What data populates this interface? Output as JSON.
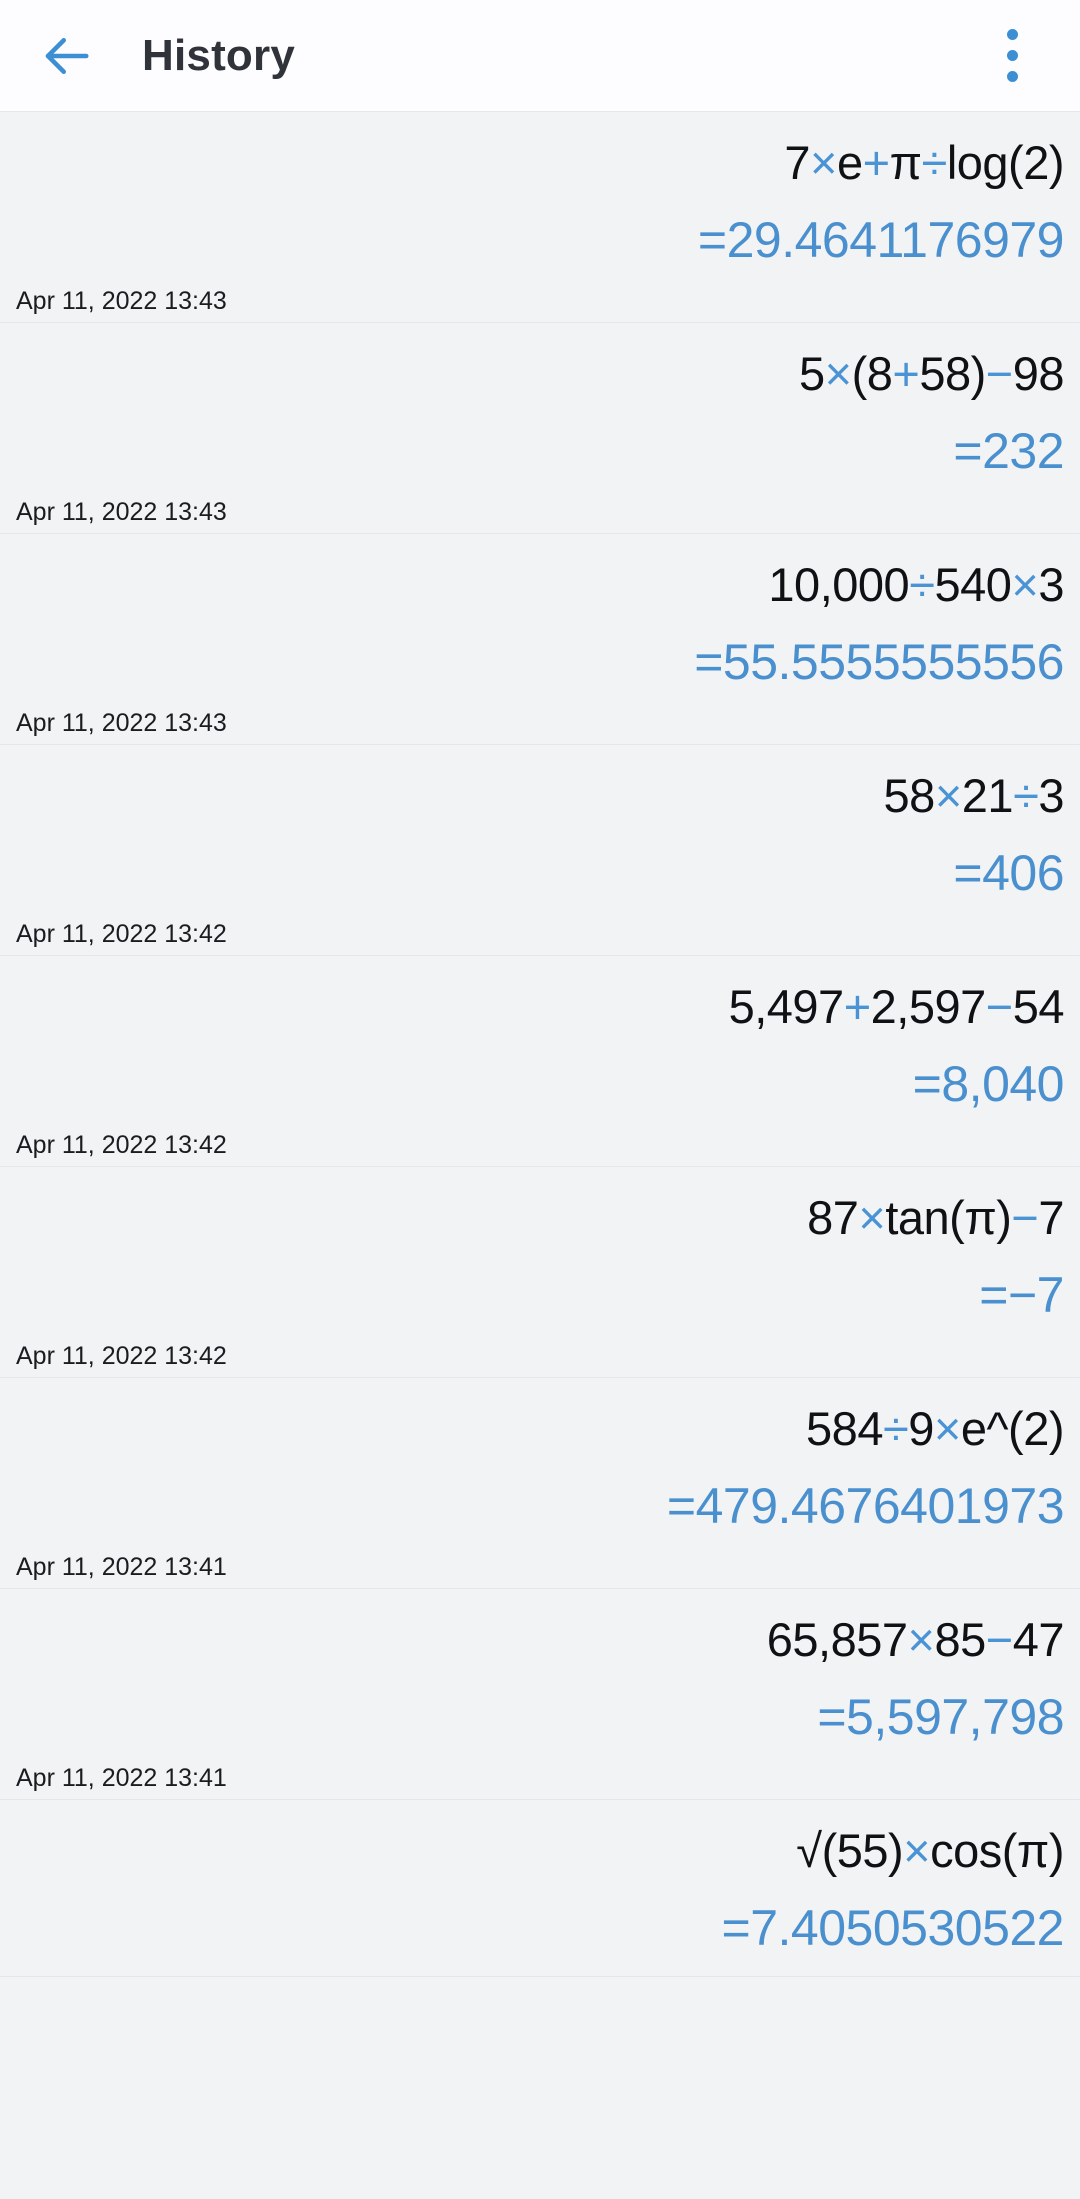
{
  "header": {
    "title": "History",
    "back_icon": "back-arrow-icon",
    "overflow_icon": "more-vertical-icon",
    "accent_color": "#3d8fd4",
    "title_color": "#30343a"
  },
  "colors": {
    "operator_blue": "#4a93d4",
    "result_blue": "#4a90cf",
    "expression_black": "#101114",
    "row_background": "#f2f3f5",
    "header_background": "#fdfdff",
    "divider": "#e4e6e9"
  },
  "history": [
    {
      "expression_parts": [
        {
          "t": "7",
          "op": false
        },
        {
          "t": "×",
          "op": true
        },
        {
          "t": "e",
          "op": false
        },
        {
          "t": "+",
          "op": true
        },
        {
          "t": "π",
          "op": false
        },
        {
          "t": "÷",
          "op": true
        },
        {
          "t": "log(2)",
          "op": false
        }
      ],
      "expression": "7×e+π÷log(2)",
      "result": "=29.4641176979",
      "timestamp": "Apr 11, 2022 13:43"
    },
    {
      "expression_parts": [
        {
          "t": "5",
          "op": false
        },
        {
          "t": "×",
          "op": true
        },
        {
          "t": "(8",
          "op": false
        },
        {
          "t": "+",
          "op": true
        },
        {
          "t": "58)",
          "op": false
        },
        {
          "t": "−",
          "op": true
        },
        {
          "t": "98",
          "op": false
        }
      ],
      "expression": "5×(8+58)−98",
      "result": "=232",
      "timestamp": "Apr 11, 2022 13:43"
    },
    {
      "expression_parts": [
        {
          "t": "10,000",
          "op": false
        },
        {
          "t": "÷",
          "op": true
        },
        {
          "t": "540",
          "op": false
        },
        {
          "t": "×",
          "op": true
        },
        {
          "t": "3",
          "op": false
        }
      ],
      "expression": "10,000÷540×3",
      "result": "=55.5555555556",
      "timestamp": "Apr 11, 2022 13:43"
    },
    {
      "expression_parts": [
        {
          "t": "58",
          "op": false
        },
        {
          "t": "×",
          "op": true
        },
        {
          "t": "21",
          "op": false
        },
        {
          "t": "÷",
          "op": true
        },
        {
          "t": "3",
          "op": false
        }
      ],
      "expression": "58×21÷3",
      "result": "=406",
      "timestamp": "Apr 11, 2022 13:42"
    },
    {
      "expression_parts": [
        {
          "t": "5,497",
          "op": false
        },
        {
          "t": "+",
          "op": true
        },
        {
          "t": "2,597",
          "op": false
        },
        {
          "t": "−",
          "op": true
        },
        {
          "t": "54",
          "op": false
        }
      ],
      "expression": "5,497+2,597−54",
      "result": "=8,040",
      "timestamp": "Apr 11, 2022 13:42"
    },
    {
      "expression_parts": [
        {
          "t": "87",
          "op": false
        },
        {
          "t": "×",
          "op": true
        },
        {
          "t": "tan(π)",
          "op": false
        },
        {
          "t": "−",
          "op": true
        },
        {
          "t": "7",
          "op": false
        }
      ],
      "expression": "87×tan(π)−7",
      "result": "=−7",
      "timestamp": "Apr 11, 2022 13:42"
    },
    {
      "expression_parts": [
        {
          "t": "584",
          "op": false
        },
        {
          "t": "÷",
          "op": true
        },
        {
          "t": "9",
          "op": false
        },
        {
          "t": "×",
          "op": true
        },
        {
          "t": "e^(2)",
          "op": false
        }
      ],
      "expression": "584÷9×e^(2)",
      "result": "=479.4676401973",
      "timestamp": "Apr 11, 2022 13:41"
    },
    {
      "expression_parts": [
        {
          "t": "65,857",
          "op": false
        },
        {
          "t": "×",
          "op": true
        },
        {
          "t": "85",
          "op": false
        },
        {
          "t": "−",
          "op": true
        },
        {
          "t": "47",
          "op": false
        }
      ],
      "expression": "65,857×85−47",
      "result": "=5,597,798",
      "timestamp": "Apr 11, 2022 13:41"
    },
    {
      "expression_parts": [
        {
          "t": "√(55)",
          "op": false
        },
        {
          "t": "×",
          "op": true
        },
        {
          "t": "cos(π)",
          "op": false
        }
      ],
      "expression": "√(55)×cos(π)",
      "result": "=7.4050530522",
      "timestamp": ""
    }
  ]
}
